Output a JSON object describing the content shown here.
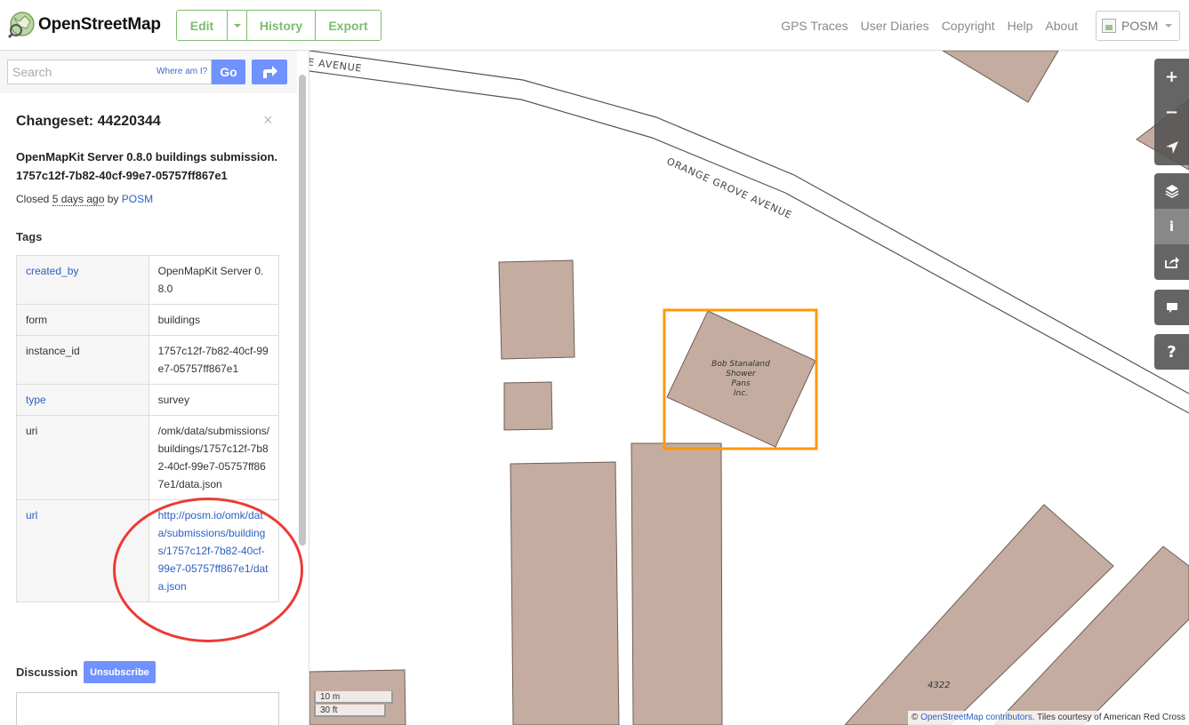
{
  "header": {
    "brand": "OpenStreetMap",
    "edit_label": "Edit",
    "history_label": "History",
    "export_label": "Export",
    "nav": [
      "GPS Traces",
      "User Diaries",
      "Copyright",
      "Help",
      "About"
    ],
    "user_name": "POSM"
  },
  "search": {
    "placeholder": "Search",
    "where_am_i": "Where am I?",
    "go_label": "Go"
  },
  "changeset": {
    "title": "Changeset: 44220344",
    "close_glyph": "×",
    "comment": "OpenMapKit Server 0.8.0 buildings submission. 1757c12f-7b82-40cf-99e7-05757ff867e1",
    "closed_prefix": "Closed ",
    "closed_ago": "5 days ago",
    "closed_by": " by ",
    "closed_user": "POSM",
    "tags_heading": "Tags",
    "tags": [
      {
        "key": "created_by",
        "value": "OpenMapKit Server 0.8.0",
        "key_link": true,
        "value_link": false
      },
      {
        "key": "form",
        "value": "buildings",
        "key_link": false,
        "value_link": false
      },
      {
        "key": "instance_id",
        "value": "1757c12f-7b82-40cf-99e7-05757ff867e1",
        "key_link": false,
        "value_link": false
      },
      {
        "key": "type",
        "value": "survey",
        "key_link": true,
        "value_link": false
      },
      {
        "key": "uri",
        "value": "/omk/data/submissions/buildings/1757c12f-7b82-40cf-99e7-05757ff867e1/data.json",
        "key_link": false,
        "value_link": false
      },
      {
        "key": "url",
        "value": "http://posm.io/omk/data/submissions/buildings/1757c12f-7b82-40cf-99e7-05757ff867e1/data.json",
        "key_link": true,
        "value_link": true
      }
    ],
    "discussion_heading": "Discussion",
    "unsubscribe_label": "Unsubscribe"
  },
  "map": {
    "street_label_1": "E AVENUE",
    "street_label_2": "ORANGE GROVE AVENUE",
    "building_label": "Bob Stanaland Shower Pans Inc.",
    "building_label_lines": [
      "Bob Stanaland",
      "Shower",
      "Pans",
      "Inc."
    ],
    "address_label": "4322",
    "scale_metric": "10 m",
    "scale_imperial": "30 ft",
    "attribution_prefix": "© ",
    "attribution_link": "OpenStreetMap contributors",
    "attribution_suffix": ". Tiles courtesy of American Red Cross",
    "controls": [
      "zoom-in",
      "zoom-out",
      "locate",
      "layers",
      "info",
      "share",
      "note",
      "query"
    ]
  },
  "colors": {
    "accent_green": "#7ebc6f",
    "button_blue": "#7092ff",
    "link_blue": "#2a5fc1",
    "building_fill": "#c4aca0",
    "highlight_orange": "#ff9900",
    "annotation_red": "#ec3a35"
  }
}
